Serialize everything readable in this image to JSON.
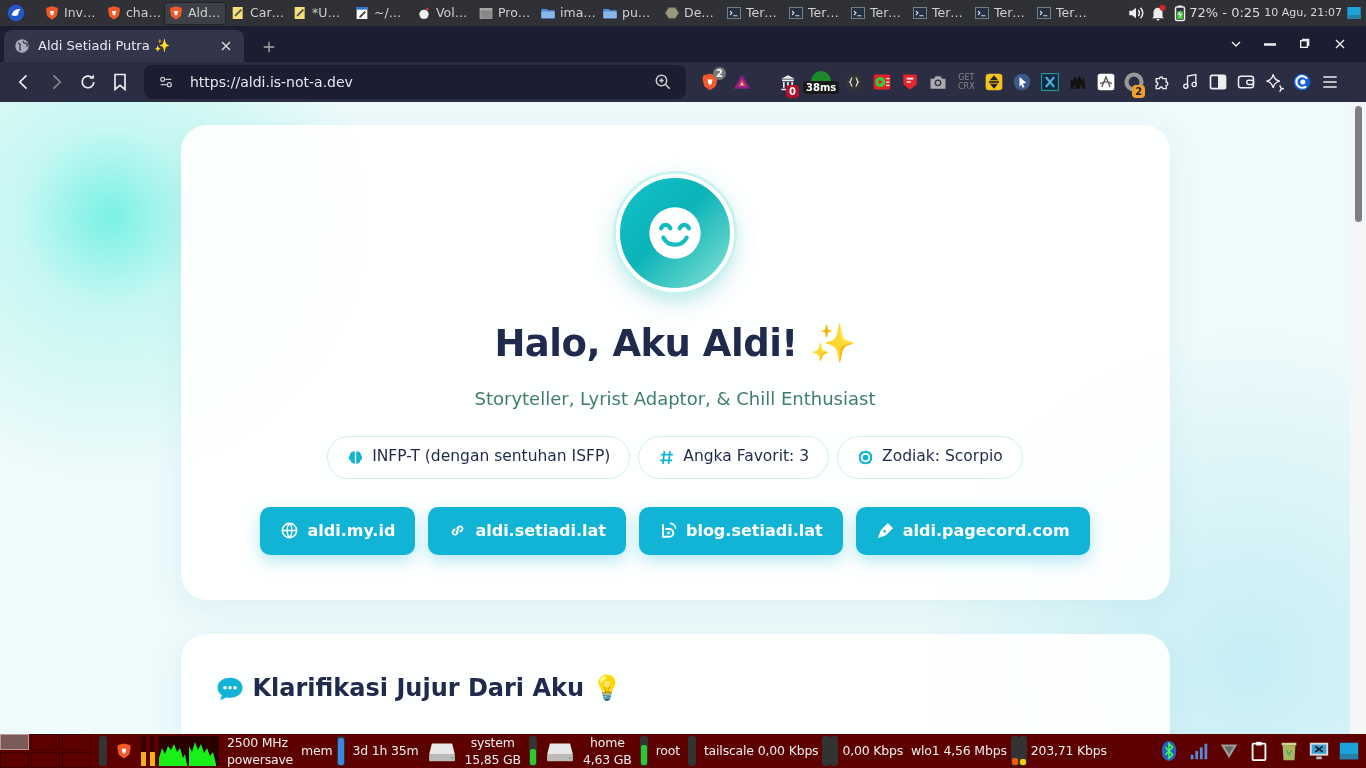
{
  "taskbar": {
    "tasks": [
      {
        "kind": "shield",
        "label": "Inv…",
        "selected": false
      },
      {
        "kind": "shield",
        "label": "cha…",
        "selected": false
      },
      {
        "kind": "shield",
        "label": "Ald…",
        "selected": true
      },
      {
        "kind": "notepad",
        "label": "Car…",
        "selected": false
      },
      {
        "kind": "notepad",
        "label": "*U…",
        "selected": false
      },
      {
        "kind": "editor",
        "label": "~/…",
        "selected": false
      },
      {
        "kind": "app",
        "label": "Vol…",
        "selected": false
      },
      {
        "kind": "window",
        "label": "Pro…",
        "selected": false
      },
      {
        "kind": "folder",
        "label": "ima…",
        "selected": false
      },
      {
        "kind": "folder",
        "label": "pu…",
        "selected": false
      },
      {
        "kind": "hexagon",
        "label": "De…",
        "selected": false
      },
      {
        "kind": "terminal",
        "label": "Ter…",
        "selected": false
      },
      {
        "kind": "terminal",
        "label": "Ter…",
        "selected": false
      },
      {
        "kind": "terminal",
        "label": "Ter…",
        "selected": false
      },
      {
        "kind": "terminal",
        "label": "Ter…",
        "selected": false
      },
      {
        "kind": "terminal",
        "label": "Ter…",
        "selected": false
      },
      {
        "kind": "terminal",
        "label": "Ter…",
        "selected": false
      }
    ],
    "battery": "72% - 0:25",
    "clock": "10 Agu, 21:07"
  },
  "browser": {
    "tabs": [
      {
        "title": "Aldi Setiadi Putra ✨",
        "selected": true
      }
    ],
    "url": "https://aldi.is-not-a.dev",
    "shield_badge": "2",
    "extensions": [
      {
        "kind": "columns",
        "badge": "0"
      },
      {
        "kind": "ping",
        "badge": "38ms"
      },
      {
        "kind": "braces"
      },
      {
        "kind": "player"
      },
      {
        "kind": "flag"
      },
      {
        "kind": "camera"
      },
      {
        "kind": "text",
        "label": "GET CRX"
      },
      {
        "kind": "arrows"
      },
      {
        "kind": "cursor"
      },
      {
        "kind": "xbox"
      },
      {
        "kind": "creature"
      },
      {
        "kind": "aslash"
      },
      {
        "kind": "ring",
        "badge": "2"
      },
      {
        "kind": "puzzle"
      },
      {
        "kind": "music"
      },
      {
        "kind": "sidebar"
      },
      {
        "kind": "wallet"
      },
      {
        "kind": "sparkle"
      },
      {
        "kind": "swirl"
      },
      {
        "kind": "menu"
      }
    ]
  },
  "profile": {
    "heading": "Halo, Aku Aldi! ✨",
    "tagline": "Storyteller, Lyrist Adaptor, & Chill Enthusiast",
    "chips": [
      {
        "label": "INFP-T (dengan sentuhan ISFP)"
      },
      {
        "label": "Angka Favorit: 3"
      },
      {
        "label": "Zodiak: Scorpio"
      }
    ],
    "links": [
      {
        "label": "aldi.my.id"
      },
      {
        "label": "aldi.setiadi.lat"
      },
      {
        "label": "blog.setiadi.lat"
      },
      {
        "label": "aldi.pagecord.com"
      }
    ]
  },
  "section": {
    "heading": "Klarifikasi Jujur Dari Aku 💡"
  },
  "panel": {
    "desktops": [
      {
        "selected": true
      },
      {
        "selected": false
      },
      {
        "selected": false
      },
      {
        "selected": false
      },
      {
        "selected": false
      },
      {
        "selected": false
      }
    ],
    "cpu": {
      "cores": [
        {
          "level": 0.45
        },
        {
          "level": 0.45
        }
      ],
      "frequency": "2500 MHz",
      "governor": "powersave"
    },
    "memory": {
      "label": "mem",
      "level": 0.95
    },
    "uptime": "3d 1h 35m",
    "disks": [
      {
        "label": "system",
        "size": "15,85 GB",
        "level": 0.55
      },
      {
        "label": "home",
        "size": "4,63 GB",
        "level": 0.7
      },
      {
        "label": "root"
      }
    ],
    "networks": [
      {
        "name": "tailscale",
        "down": "0,00 Kbps",
        "up": "0,00 Kbps"
      },
      {
        "name": "wlo1",
        "down": "4,56 Mbps",
        "meters": [
          {
            "level": 0.25
          },
          {
            "level": 0.2
          }
        ],
        "up": "203,71 Kbps"
      }
    ],
    "tray": [
      {
        "kind": "bluetooth"
      },
      {
        "kind": "signal"
      },
      {
        "kind": "vpn"
      },
      {
        "kind": "clipboard"
      },
      {
        "kind": "trash"
      },
      {
        "kind": "screenshot"
      },
      {
        "kind": "desktop"
      }
    ]
  }
}
